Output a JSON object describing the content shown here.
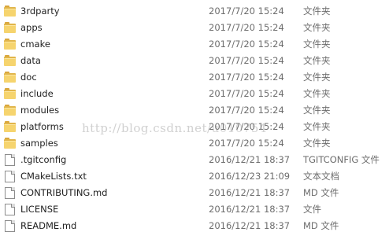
{
  "files": [
    {
      "name": "3rdparty",
      "date": "2017/7/20 15:24",
      "type": "文件夹",
      "icon": "folder-icon"
    },
    {
      "name": "apps",
      "date": "2017/7/20 15:24",
      "type": "文件夹",
      "icon": "folder-icon"
    },
    {
      "name": "cmake",
      "date": "2017/7/20 15:24",
      "type": "文件夹",
      "icon": "folder-icon"
    },
    {
      "name": "data",
      "date": "2017/7/20 15:24",
      "type": "文件夹",
      "icon": "folder-icon"
    },
    {
      "name": "doc",
      "date": "2017/7/20 15:24",
      "type": "文件夹",
      "icon": "folder-icon"
    },
    {
      "name": "include",
      "date": "2017/7/20 15:24",
      "type": "文件夹",
      "icon": "folder-icon"
    },
    {
      "name": "modules",
      "date": "2017/7/20 15:24",
      "type": "文件夹",
      "icon": "folder-icon"
    },
    {
      "name": "platforms",
      "date": "2017/7/20 15:24",
      "type": "文件夹",
      "icon": "folder-icon"
    },
    {
      "name": "samples",
      "date": "2017/7/20 15:24",
      "type": "文件夹",
      "icon": "folder-icon"
    },
    {
      "name": ".tgitconfig",
      "date": "2016/12/21 18:37",
      "type": "TGITCONFIG 文件",
      "icon": "file-icon"
    },
    {
      "name": "CMakeLists.txt",
      "date": "2016/12/23 21:09",
      "type": "文本文档",
      "icon": "file-icon"
    },
    {
      "name": "CONTRIBUTING.md",
      "date": "2016/12/21 18:37",
      "type": "MD 文件",
      "icon": "file-icon"
    },
    {
      "name": "LICENSE",
      "date": "2016/12/21 18:37",
      "type": "文件",
      "icon": "file-icon"
    },
    {
      "name": "README.md",
      "date": "2016/12/21 18:37",
      "type": "MD 文件",
      "icon": "file-icon"
    }
  ],
  "watermark": "http://blog.csdn.net/u010754",
  "colors": {
    "folder": "#f6d46e",
    "secondary_text": "#6d6d6d"
  }
}
